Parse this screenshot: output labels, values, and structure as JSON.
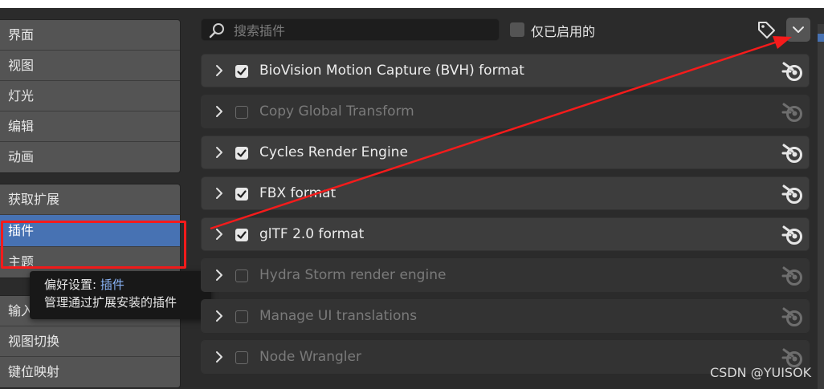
{
  "sidebar": {
    "group1": [
      "界面",
      "视图",
      "灯光",
      "编辑",
      "动画"
    ],
    "group2": [
      "获取扩展",
      "插件",
      "主题"
    ],
    "group3": [
      "输入",
      "视图切换",
      "键位映射"
    ],
    "active": "插件"
  },
  "tooltip": {
    "prefix": "偏好设置: ",
    "highlight": "插件",
    "description": "管理通过扩展安装的插件"
  },
  "toolbar": {
    "search_placeholder": "搜索插件",
    "enabled_only_label": "仅已启用的",
    "tag_icon": "tag-icon",
    "dropdown_icon": "chevron-down-icon"
  },
  "addons": [
    {
      "name": "BioVision Motion Capture (BVH) format",
      "enabled": true
    },
    {
      "name": "Copy Global Transform",
      "enabled": false
    },
    {
      "name": "Cycles Render Engine",
      "enabled": true
    },
    {
      "name": "FBX format",
      "enabled": true
    },
    {
      "name": "glTF 2.0 format",
      "enabled": true
    },
    {
      "name": "Hydra Storm render engine",
      "enabled": false
    },
    {
      "name": "Manage UI translations",
      "enabled": false
    },
    {
      "name": "Node Wrangler",
      "enabled": false
    }
  ],
  "watermark": "CSDN @YUISOK",
  "colors": {
    "accent": "#4772b3",
    "annotation": "#f51b1b"
  }
}
